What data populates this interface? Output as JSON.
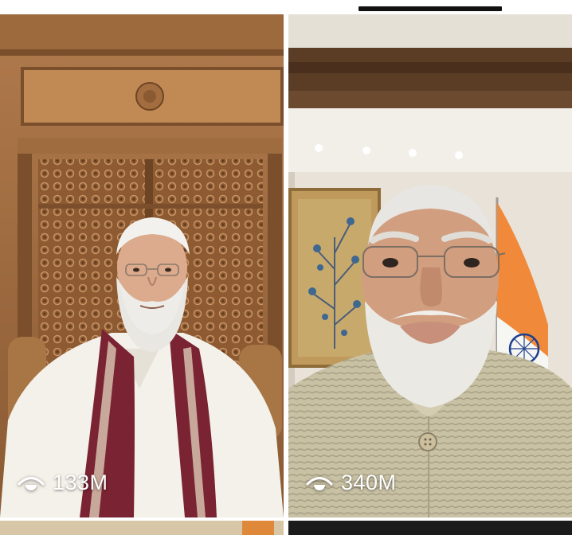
{
  "feed": {
    "tiles": [
      {
        "views": "133M",
        "view_icon": "eye-icon"
      },
      {
        "views": "340M",
        "view_icon": "eye-icon"
      }
    ]
  },
  "colors": {
    "text": "#ffffff",
    "flag_saffron": "#f08a3a",
    "flag_green": "#2f8a3a",
    "chakra": "#1c3f8f"
  }
}
